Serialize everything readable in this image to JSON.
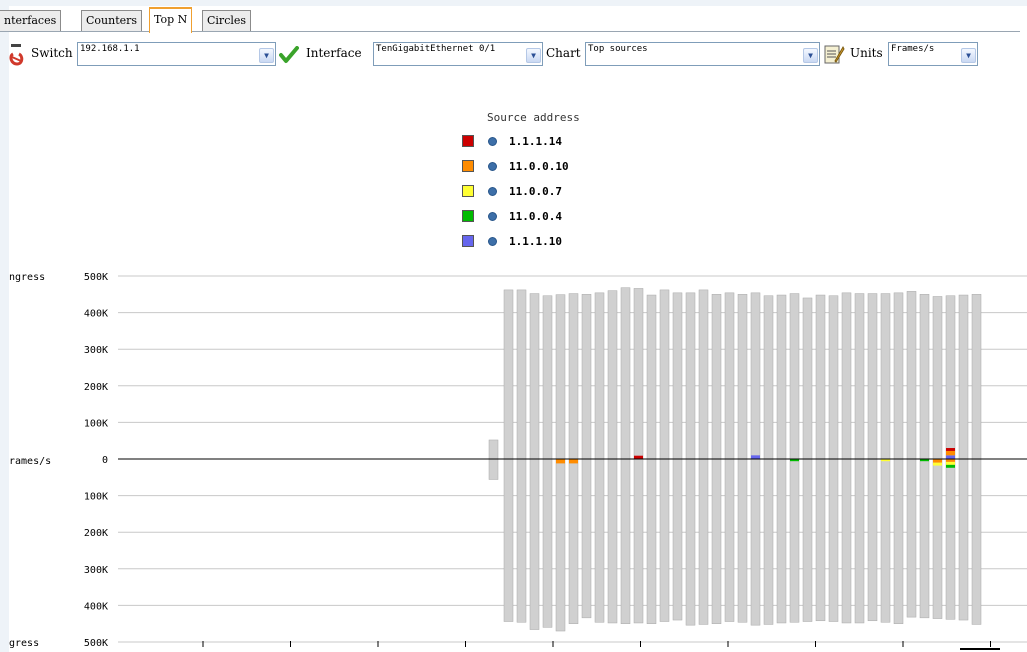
{
  "tabs": [
    {
      "label": "nterfaces",
      "active": false
    },
    {
      "label": "Counters",
      "active": false
    },
    {
      "label": "Top N",
      "active": true
    },
    {
      "label": "Circles",
      "active": false
    }
  ],
  "toolbar": {
    "switch_label": "Switch",
    "switch_value": "192.168.1.1",
    "interface_label": "Interface",
    "interface_value": "TenGigabitEthernet 0/1",
    "chart_label": "Chart",
    "chart_value": "Top sources",
    "units_label": "Units",
    "units_value": "Frames/s",
    "dropdown_glyph": "▼"
  },
  "legend": {
    "title": "Source address",
    "items": [
      {
        "label": "1.1.1.14",
        "color": "#cc0000"
      },
      {
        "label": "11.0.0.10",
        "color": "#ff8c00"
      },
      {
        "label": "11.0.0.7",
        "color": "#ffff33"
      },
      {
        "label": "11.0.0.4",
        "color": "#00bb00"
      },
      {
        "label": "1.1.1.10",
        "color": "#6666ee"
      }
    ]
  },
  "chart_data": {
    "type": "bar",
    "ylabel_top": "ngress",
    "ylabel_mid": "rames/s",
    "ylabel_bottom": "gress",
    "ingress_ticks": [
      "500K",
      "400K",
      "300K",
      "200K",
      "100K",
      "0"
    ],
    "egress_ticks": [
      "100K",
      "200K",
      "300K",
      "400K",
      "500K"
    ],
    "ylim": [
      -500000,
      500000
    ],
    "bar_color": "#d0d0d0",
    "series_colors": {
      "1.1.1.14": "#cc0000",
      "11.0.0.10": "#ff8c00",
      "11.0.0.7": "#ffff33",
      "11.0.0.4": "#00bb00",
      "1.1.1.10": "#6666ee"
    },
    "ingress": [
      52000,
      462000,
      462000,
      452000,
      446000,
      449000,
      452000,
      450000,
      454000,
      460000,
      468000,
      466000,
      448000,
      462000,
      454000,
      454000,
      462000,
      450000,
      454000,
      450000,
      454000,
      446000,
      448000,
      452000,
      440000,
      448000,
      446000,
      454000,
      452000,
      452000,
      452000,
      454000,
      458000,
      450000,
      444000,
      446000,
      448000,
      450000
    ],
    "egress": [
      56000,
      444000,
      446000,
      466000,
      460000,
      470000,
      450000,
      434000,
      446000,
      448000,
      450000,
      448000,
      450000,
      444000,
      440000,
      454000,
      452000,
      450000,
      444000,
      446000,
      454000,
      452000,
      448000,
      446000,
      444000,
      442000,
      444000,
      448000,
      448000,
      442000,
      446000,
      450000,
      432000,
      434000,
      436000,
      438000,
      440000,
      452000
    ],
    "highlights": [
      {
        "bar": 5,
        "source": "11.0.0.10",
        "dir": "egress",
        "value": 12000
      },
      {
        "bar": 6,
        "source": "11.0.0.10",
        "dir": "egress",
        "value": 12000
      },
      {
        "bar": 11,
        "source": "1.1.1.14",
        "dir": "ingress",
        "value": 9000
      },
      {
        "bar": 20,
        "source": "1.1.1.10",
        "dir": "ingress",
        "value": 10000
      },
      {
        "bar": 23,
        "source": "11.0.0.4",
        "dir": "egress",
        "value": 6000
      },
      {
        "bar": 30,
        "source": "11.0.0.7",
        "dir": "egress",
        "value": 6000
      },
      {
        "bar": 33,
        "source": "11.0.0.4",
        "dir": "egress",
        "value": 6000
      },
      {
        "bar": 34,
        "source": "11.0.0.10",
        "dir": "egress",
        "value": 10000
      },
      {
        "bar": 34,
        "source": "11.0.0.7",
        "dir": "egress",
        "value": 8000
      },
      {
        "bar": 35,
        "source": "1.1.1.10",
        "dir": "ingress",
        "value": 10000
      },
      {
        "bar": 35,
        "source": "11.0.0.10",
        "dir": "ingress",
        "value": 12000
      },
      {
        "bar": 35,
        "source": "1.1.1.14",
        "dir": "ingress",
        "value": 8000
      },
      {
        "bar": 35,
        "source": "11.0.0.10",
        "dir": "egress",
        "value": 8000
      },
      {
        "bar": 35,
        "source": "11.0.0.7",
        "dir": "egress",
        "value": 8000
      },
      {
        "bar": 35,
        "source": "11.0.0.4",
        "dir": "egress",
        "value": 8000
      }
    ],
    "grid": true
  }
}
